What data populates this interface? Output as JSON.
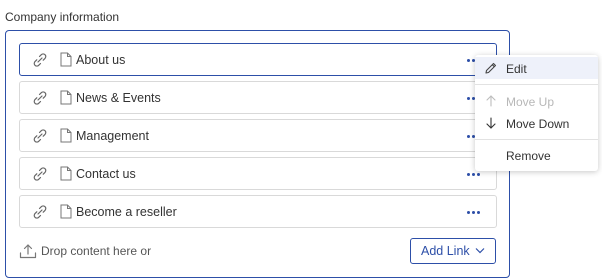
{
  "section": {
    "title": "Company information"
  },
  "items": [
    {
      "label": "About us"
    },
    {
      "label": "News & Events"
    },
    {
      "label": "Management"
    },
    {
      "label": "Contact us"
    },
    {
      "label": "Become a reseller"
    }
  ],
  "drop": {
    "text": "Drop content here or"
  },
  "add_link": {
    "label": "Add Link"
  },
  "context_menu": {
    "edit": "Edit",
    "move_up": "Move Up",
    "move_down": "Move Down",
    "remove": "Remove"
  },
  "colors": {
    "accent": "#2d4fa8",
    "border": "#d9d9d9",
    "hover": "#eef1fa",
    "disabled": "#b8b8b8"
  }
}
